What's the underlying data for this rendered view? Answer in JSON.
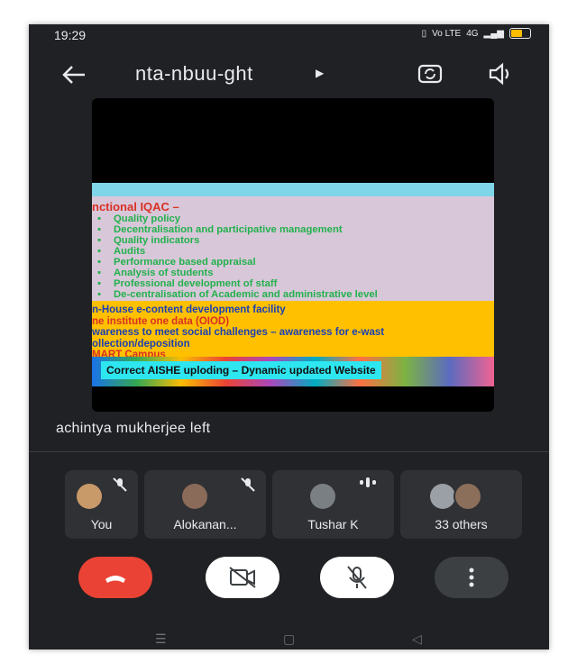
{
  "status_bar": {
    "time": "19:29",
    "network_label": "Vo LTE",
    "signal_label": "4G",
    "battery_level": 0.55,
    "battery_color": "#fbbc04"
  },
  "meeting": {
    "code": "nta-nbuu-ght",
    "notice": "achintya mukherjee left"
  },
  "shared_slide": {
    "heading": "nctional IQAC –",
    "bullets": [
      "Quality policy",
      "Decentralisation and participative management",
      "Quality indicators",
      "Audits",
      "Performance based appraisal",
      "Analysis of students",
      "Professional development of staff",
      "De-centralisation of Academic and administrative level"
    ],
    "lines": [
      {
        "text": "n-House e-content development facility",
        "color": "#1a3fb5"
      },
      {
        "text": "ne institute one data (OIOD)",
        "color": "#d93025"
      },
      {
        "text": "wareness to meet social challenges – awareness for e-wast",
        "color": "#1a3fb5"
      },
      {
        "text": "ollection/deposition",
        "color": "#1a3fb5"
      },
      {
        "text": "MART Campus",
        "color": "#d93025"
      }
    ],
    "banner": "Correct AISHE uploding – Dynamic updated Website"
  },
  "participants": [
    {
      "name": "You",
      "muted": true,
      "avatar_color": "#c89a6a"
    },
    {
      "name": "Alokanan...",
      "muted": true,
      "avatar_color": "#8a6a58"
    },
    {
      "name": "Tushar K",
      "muted": false,
      "speaking": true,
      "avatar_color": "#7a7f84"
    },
    {
      "name": "33 others",
      "avatar_colors": [
        "#9aa0a6",
        "#8b6f5a"
      ]
    }
  ],
  "controls": {
    "end_call_color": "#ea4335",
    "button_light_color": "#ffffff",
    "button_dark_color": "#3c4043"
  },
  "icons": [
    "back-arrow-icon",
    "switch-camera-icon",
    "speaker-icon",
    "end-call-icon",
    "camera-off-icon",
    "mic-off-icon",
    "more-options-icon"
  ]
}
